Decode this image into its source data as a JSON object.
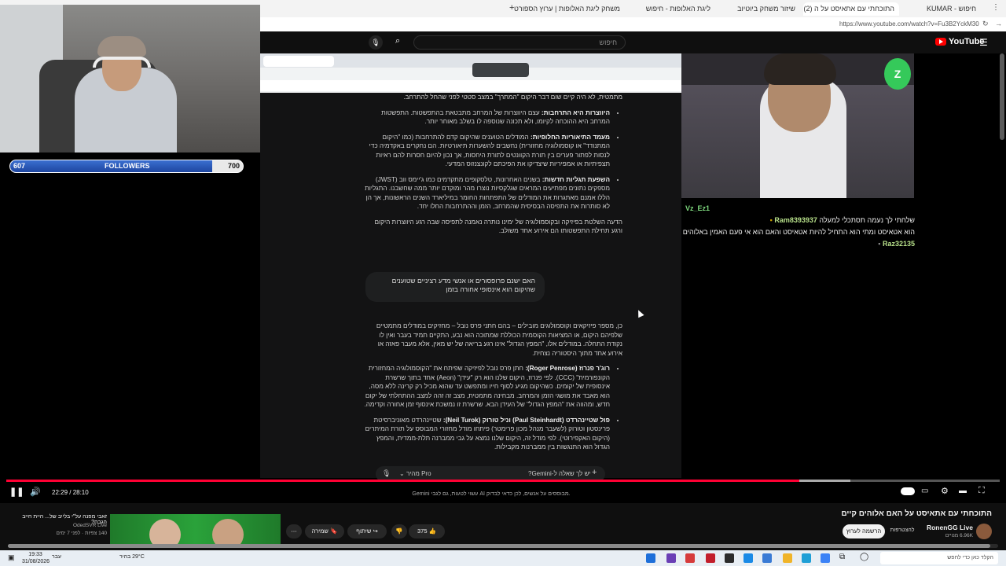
{
  "browser": {
    "tabs": [
      {
        "label": "חיפוש - KUMAR"
      },
      {
        "label": "התוכחתי עם אתאיסט על ה (2)",
        "active": true
      },
      {
        "label": "שיזור משחק ביוטיוב"
      },
      {
        "label": "ליגת האלופות - חיפוש"
      },
      {
        "label": "משחק ליגת האלופות | ערוץ הספורט"
      }
    ],
    "url": "https://www.youtube.com/watch?v=Fu3B2YckM30"
  },
  "youtube": {
    "logo": "YouTube",
    "search_placeholder": "חיפוש"
  },
  "gemini": {
    "paragraphs": [
      {
        "bold": "",
        "text": "מתמטית, לא היה קיים שום דבר היקום \"המתרך\" במצב סטטי לפני שהחל להתרחב.",
        "bullet": false
      },
      {
        "bold": "היווצרות היא התרחבות:",
        "text": "עצם היווצרות של המרחב מתבטאת בהתפשטות. התפשטות המרחב היא ההוכחה לקיומו, ולא תכונה שנוספה לו בשלב מאוחר יותר.",
        "bullet": true
      },
      {
        "bold": "מעמד התיאוריות החלופיות:",
        "text": "המודלים הטוענים שהיקום קדם להתרחבות (כמו \"היקום המתנודד\" או קוסמולוגיה מחזורית) נחשבים להשערות תיאורטיות. הם נחקרים באקדמיה כדי לנסות לפתור פערים בין תורת הקוונטים לתורת היחסות, אך נכון להיום חסרות להם ראיות תצפיתיות או אמפיריות שיצדיקו את הפיכתם לקונצנזוס המדעי.",
        "bullet": true
      },
      {
        "bold": "השפעת תגליות חדשות:",
        "text": "בשנים האחרונות, טלסקופים מתקדמים כמו ג'יימס ווב (JWST) מספקים נתונים מפתיעים המראים שגלקסיות נוצרו מהר ומוקדם יותר ממה שחשבנו. התגליות הללו אמנם מאתגרות את המודלים של התפתחות החומר במיליארד השנים הראשונות, אך הן לא סותרות את התפיסה הבסיסית שהמרחב, הזמן וההתרחבות החלו יחד.",
        "bullet": true
      },
      {
        "bold": "",
        "text": "הדעה השלטת בפיזיקה ובקוסמולוגיה של ימינו נותרה נאמנה לתפיסה שבה רגע היווצרות היקום ורגע תחילת התפשטותו הם אירוע אחד משולב.",
        "bullet": false
      }
    ],
    "user_question": "האם ישנם פרופסורים או אנשי מדע רציניים שטוענים שהיקום הוא אינסופי אחורה בזמן",
    "answer": [
      {
        "bold": "",
        "text": "כן, מספר פיזיקאים וקוסמולוגים מובילים – בהם חתני פרס נובל – מחזיקים במודלים מתמטיים שלפיהם היקום, או המציאות הקוסמית הכוללת שמתוכה הוא נבע, התקיים תמיד בעבר ואין לו נקודת התחלה. במודלים אלו, \"המפץ הגדול\" אינו רגע בריאה של יש מאין, אלא מעבר פאזה או אירוע אחד מתוך היסטוריה נצחית.",
        "bullet": false
      },
      {
        "bold": "רוג'ר פנרוז (Roger Penrose):",
        "text": "חתן פרס נובל לפיזיקה שפיתח את \"הקוסמולוגיה המחזורית הקונפורמית\" (CCC). לפי פנרוז, היקום שלנו הוא רק \"עידן\" (Aeon) אחד בתוך שרשרת אינסופית של יקומים. כשהיקום מגיע לסוף חייו ומתפשט עד שהוא מכיל רק קרינה ללא מסה, הוא מאבד את מושגי הזמן והמרחב. מבחינה מתמטית, מצב זה זהה למצב ההתחלתי של יקום חדש, ומהווה את \"המפץ הגדול\" של העידן הבא. שרשרת זו נמשכת אינסוף זמן אחורה וקדימה.",
        "bullet": true
      },
      {
        "bold": "פול שטיינהרדט (Paul Steinhardt) וניל טורוק (Neil Turok):",
        "text": "שטיינהרדט מאוניברסיטת פרינסטון וטורוק (לשעבר מנהל מכון פרימטר) פיתחו מודל מחזורי המבוסס על תורת המיתרים (היקום האקפירוטי). לפי מודל זה, היקום שלנו נמצא על גבי ממברנה תלת-ממדית, והמפץ הגדול הוא התנגשות בין ממברנות מקבילות.",
        "bullet": true
      }
    ],
    "input_placeholder": "יש לך שאלה ל-Gemini?",
    "model_label": "Pro",
    "mode_label": "מהיר",
    "disclaimer": "Gemini עשוי לטעות, גם לגבי AI מבוססים על אנשים, לכן כדאי לבדוק."
  },
  "overlay": {
    "followers_label": "FOLLOWERS",
    "followers_current": "607",
    "followers_goal": "700",
    "followers_fraction": 0.867
  },
  "chat": {
    "messages": [
      {
        "user": "Vz_Ez1",
        "text": "",
        "color": "#7dd87d"
      },
      {
        "user": "Ram8393937",
        "text": "שלחתי לך נעמה תסתכלי למעלה",
        "color": "#b7e08a"
      },
      {
        "user": "Raz32135",
        "text": "הוא אטאיסט ומתי הוא התחיל להיות אטאיסט והאם הוא אי פעם האמין באלוהים",
        "color": "#b7e08a"
      }
    ]
  },
  "player": {
    "time": "22:29 / 28:10",
    "progress_fraction": 0.798,
    "buffer_fraction": 0.85
  },
  "video_meta": {
    "title": "התוכחתי עם אתאיסט על האם אלוהים קיים",
    "channel": "RonenGG Live",
    "subscribers": "6.96K מנויים",
    "subscribe_label": "הרשמה לערוץ",
    "join_label": "להצטרפות",
    "likes": "375",
    "share_label": "שיתוף",
    "save_label": "שמירה",
    "related_title": "זאבי מפנה על\"י בלייב של... היית חייב הגבה?",
    "related_channel": "OdedSVR Live",
    "related_views": "140 צפיות · לפני 7 ימים"
  },
  "taskbar": {
    "weather": "29°C בהיר",
    "time": "19:33",
    "date": "31/08/2026",
    "search_placeholder": "הקלד כאן כדי לחפש",
    "lang": "עבר"
  }
}
